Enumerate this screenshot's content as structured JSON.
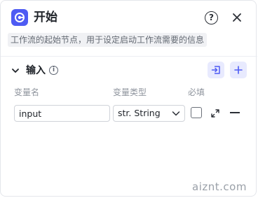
{
  "node": {
    "title": "开始",
    "description": "工作流的起始节点，用于设定启动工作流需要的信息",
    "icon": "start-node-icon",
    "accent_color": "#4e5bf3"
  },
  "header": {
    "help_label": "?",
    "help_icon": "question-circle-icon",
    "close_icon": "close-icon"
  },
  "input_section": {
    "label": "输入",
    "info_glyph": "i",
    "import_icon": "import-icon",
    "add_icon": "plus-icon",
    "columns": {
      "name": "变量名",
      "type": "变量类型",
      "required": "必填"
    },
    "rows": [
      {
        "name": "input",
        "type": "str. String",
        "required": false
      }
    ]
  },
  "watermark": "aiznt.com"
}
